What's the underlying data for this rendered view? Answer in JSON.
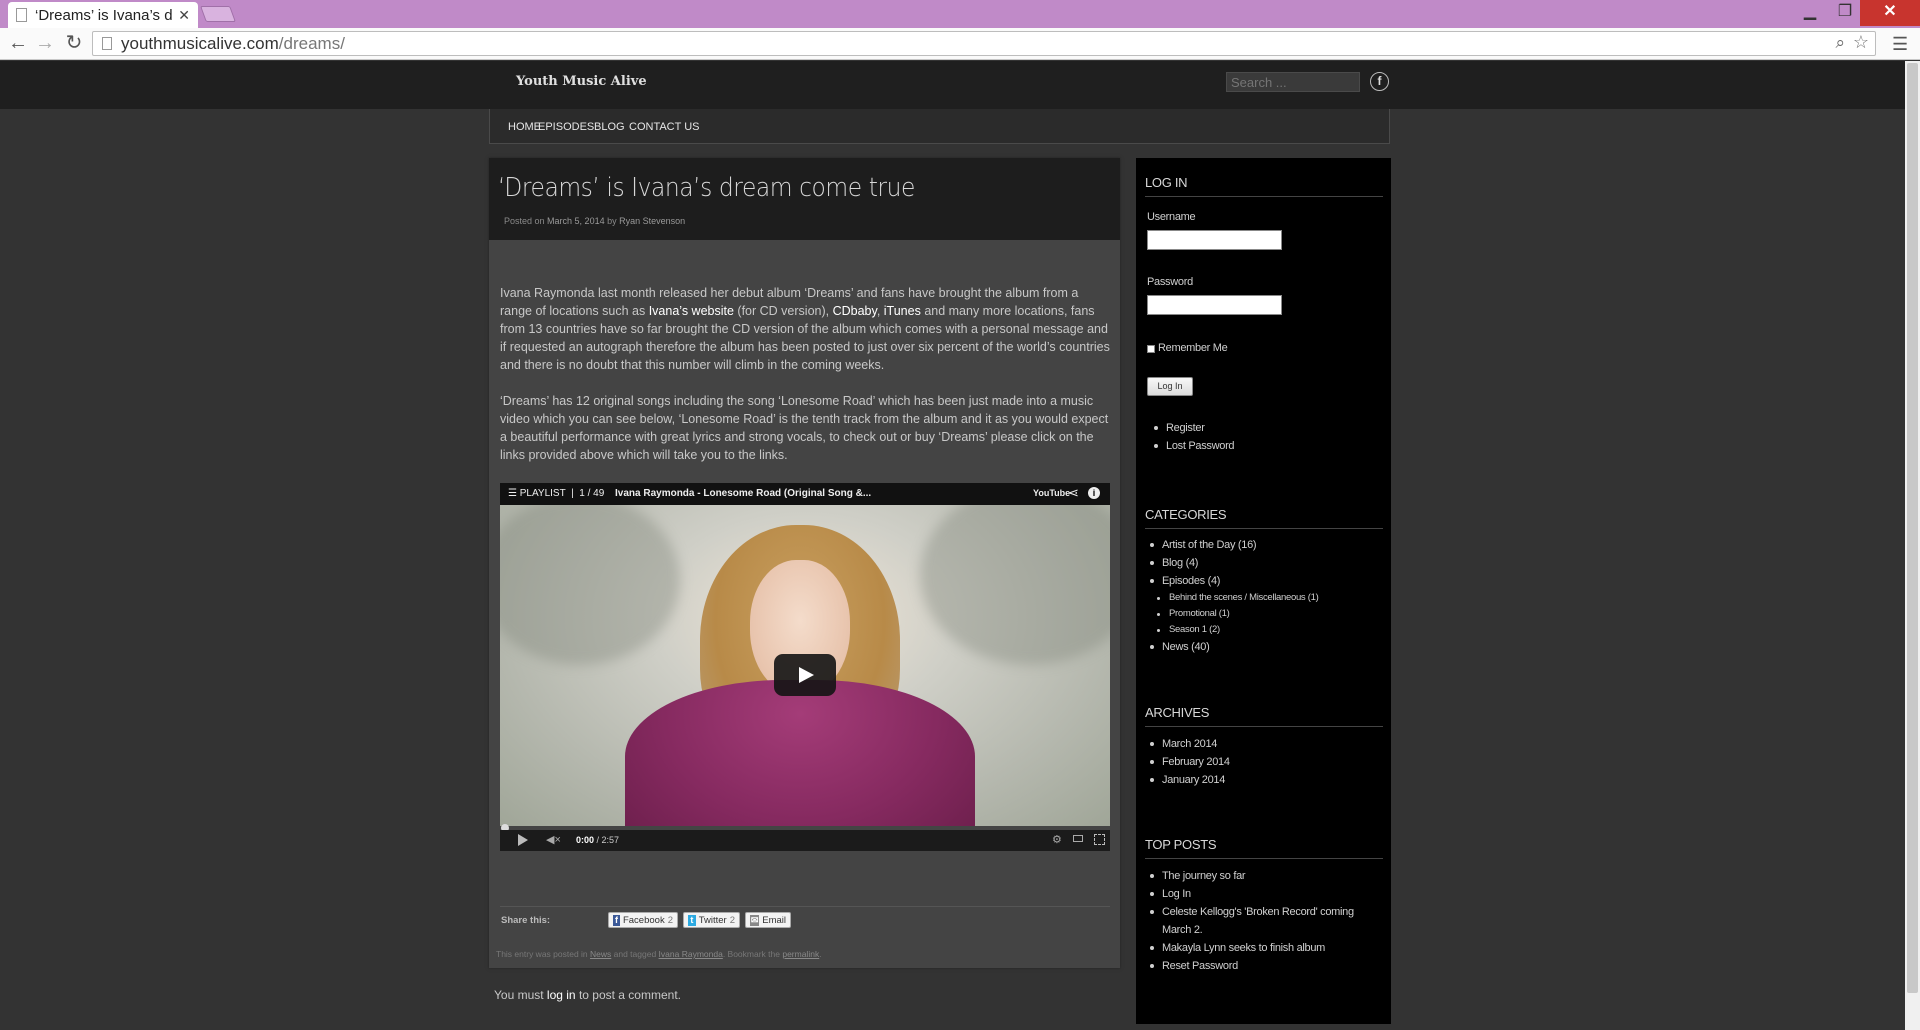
{
  "browser": {
    "tab_title": "‘Dreams’ is Ivana’s dr",
    "url_domain": "youthmusicalive.com",
    "url_path": "/dreams/"
  },
  "site": {
    "title": "Youth Music Alive",
    "search_placeholder": "Search ..."
  },
  "nav": {
    "items": [
      "HOME",
      "EPISODES",
      "BLOG",
      "CONTACT US"
    ]
  },
  "post": {
    "title": "‘Dreams’ is Ivana’s dream come true",
    "meta_prefix": "Posted on",
    "date": "March 5, 2014",
    "meta_by": "by",
    "author": "Ryan Stevenson",
    "p1_a": "Ivana Raymonda last month released her debut album ‘Dreams’ and fans have brought the album from a range of locations such as ",
    "p1_link1": "Ivana’s website",
    "p1_b": " (for CD version), ",
    "p1_link2": "CDbaby",
    "p1_c": ", ",
    "p1_link3": "iTunes",
    "p1_d": " and many more locations, fans from 13 countries have so far brought the CD version of the album which comes with a personal message and  if requested an autograph therefore the album has been posted to just over six percent of the world’s countries and there is no doubt that this number will climb in the coming weeks.",
    "p2": "‘Dreams’ has 12 original songs including the song ‘Lonesome Road’ which has been just made into a music video which you can see below, ‘Lonesome Road’ is the tenth track from the album and it as you would expect a beautiful performance with great lyrics and strong vocals, to check out or buy ‘Dreams’ please click on the links provided above which will take you to the links."
  },
  "video": {
    "playlist_label": "PLAYLIST",
    "position": "1 / 49",
    "title": "Ivana Raymonda - Lonesome Road (Original Song &...",
    "brand": "YouTube",
    "time_current": "0:00",
    "time_total": "/ 2:57"
  },
  "share": {
    "label": "Share this:",
    "facebook": "Facebook",
    "facebook_count": "2",
    "twitter": "Twitter",
    "twitter_count": "2",
    "email": "Email"
  },
  "entry_footer": {
    "t1": "This entry was posted in ",
    "category": "News",
    "t2": " and tagged ",
    "tag": "Ivana Raymonda",
    "t3": ". Bookmark the ",
    "permalink": "permalink",
    "t4": "."
  },
  "comments": {
    "t1": "You must ",
    "link": "log in",
    "t2": " to post a comment."
  },
  "sidebar": {
    "login_title": "LOG IN",
    "username_label": "Username",
    "password_label": "Password",
    "remember_label": "Remember Me",
    "login_button": "Log In",
    "login_links": [
      "Register",
      "Lost Password"
    ],
    "categories_title": "CATEGORIES",
    "categories": [
      {
        "name": "Artist of the Day",
        "count": "(16)"
      },
      {
        "name": "Blog",
        "count": "(4)"
      },
      {
        "name": "Episodes",
        "count": "(4)"
      },
      {
        "name": "Behind the scenes / Miscellaneous",
        "count": "(1)"
      },
      {
        "name": "Promotional",
        "count": "(1)"
      },
      {
        "name": "Season 1",
        "count": "(2)"
      },
      {
        "name": "News",
        "count": "(40)"
      }
    ],
    "archives_title": "ARCHIVES",
    "archives": [
      "March 2014",
      "February 2014",
      "January 2014"
    ],
    "top_posts_title": "TOP POSTS",
    "top_posts": [
      "The journey so far",
      "Log In",
      "Celeste Kellogg's 'Broken Record' coming March 2.",
      "Makayla Lynn seeks to finish album",
      "Reset Password"
    ]
  }
}
